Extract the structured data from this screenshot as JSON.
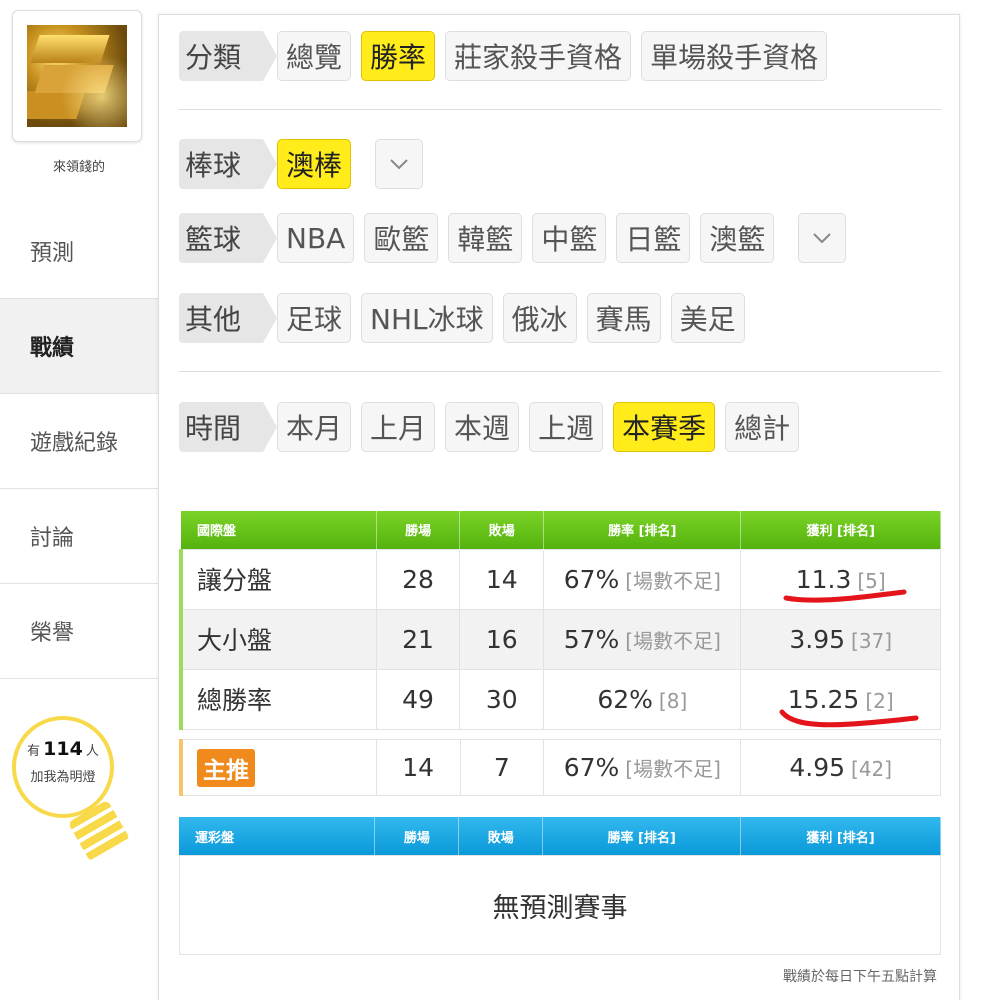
{
  "user": {
    "name": "來領錢的"
  },
  "nav": [
    {
      "label": "預測",
      "active": false
    },
    {
      "label": "戰績",
      "active": true
    },
    {
      "label": "遊戲紀錄",
      "active": false
    },
    {
      "label": "討論",
      "active": false
    },
    {
      "label": "榮譽",
      "active": false
    }
  ],
  "fans": {
    "prefix": "有",
    "count": "114",
    "suffix": "人",
    "line2": "加我為明燈"
  },
  "filters": {
    "category": {
      "label": "分類",
      "options": [
        "總覽",
        "勝率",
        "莊家殺手資格",
        "單場殺手資格"
      ],
      "selected": "勝率"
    },
    "baseball": {
      "label": "棒球",
      "options": [
        "澳棒"
      ],
      "selected": "澳棒"
    },
    "basketball": {
      "label": "籃球",
      "options": [
        "NBA",
        "歐籃",
        "韓籃",
        "中籃",
        "日籃",
        "澳籃"
      ],
      "selected": ""
    },
    "other": {
      "label": "其他",
      "options": [
        "足球",
        "NHL冰球",
        "俄冰",
        "賽馬",
        "美足"
      ],
      "selected": ""
    },
    "time": {
      "label": "時間",
      "options": [
        "本月",
        "上月",
        "本週",
        "上週",
        "本賽季",
        "總計"
      ],
      "selected": "本賽季"
    }
  },
  "intl_table": {
    "headers": [
      "國際盤",
      "勝場",
      "敗場",
      "勝率 [排名]",
      "獲利 [排名]"
    ],
    "rows": [
      {
        "name": "讓分盤",
        "wins": "28",
        "losses": "14",
        "rate": "67%",
        "rate_rank": "[場數不足]",
        "profit": "11.3",
        "profit_rank": "[5]"
      },
      {
        "name": "大小盤",
        "wins": "21",
        "losses": "16",
        "rate": "57%",
        "rate_rank": "[場數不足]",
        "profit": "3.95",
        "profit_rank": "[37]"
      },
      {
        "name": "總勝率",
        "wins": "49",
        "losses": "30",
        "rate": "62%",
        "rate_rank": "[8]",
        "profit": "15.25",
        "profit_rank": "[2]"
      }
    ]
  },
  "pick_row": {
    "badge": "主推",
    "wins": "14",
    "losses": "7",
    "rate": "67%",
    "rate_rank": "[場數不足]",
    "profit": "4.95",
    "profit_rank": "[42]"
  },
  "sports_table": {
    "headers": [
      "運彩盤",
      "勝場",
      "敗場",
      "勝率 [排名]",
      "獲利 [排名]"
    ],
    "empty_text": "無預測賽事"
  },
  "footnote": "戰績於每日下午五點計算",
  "colors": {
    "selected_chip": "#ffec1a",
    "header_green": "#5ab716",
    "header_blue": "#0fa0dd",
    "pick_badge": "#f08a1c",
    "annotation_red": "#e4141b"
  }
}
